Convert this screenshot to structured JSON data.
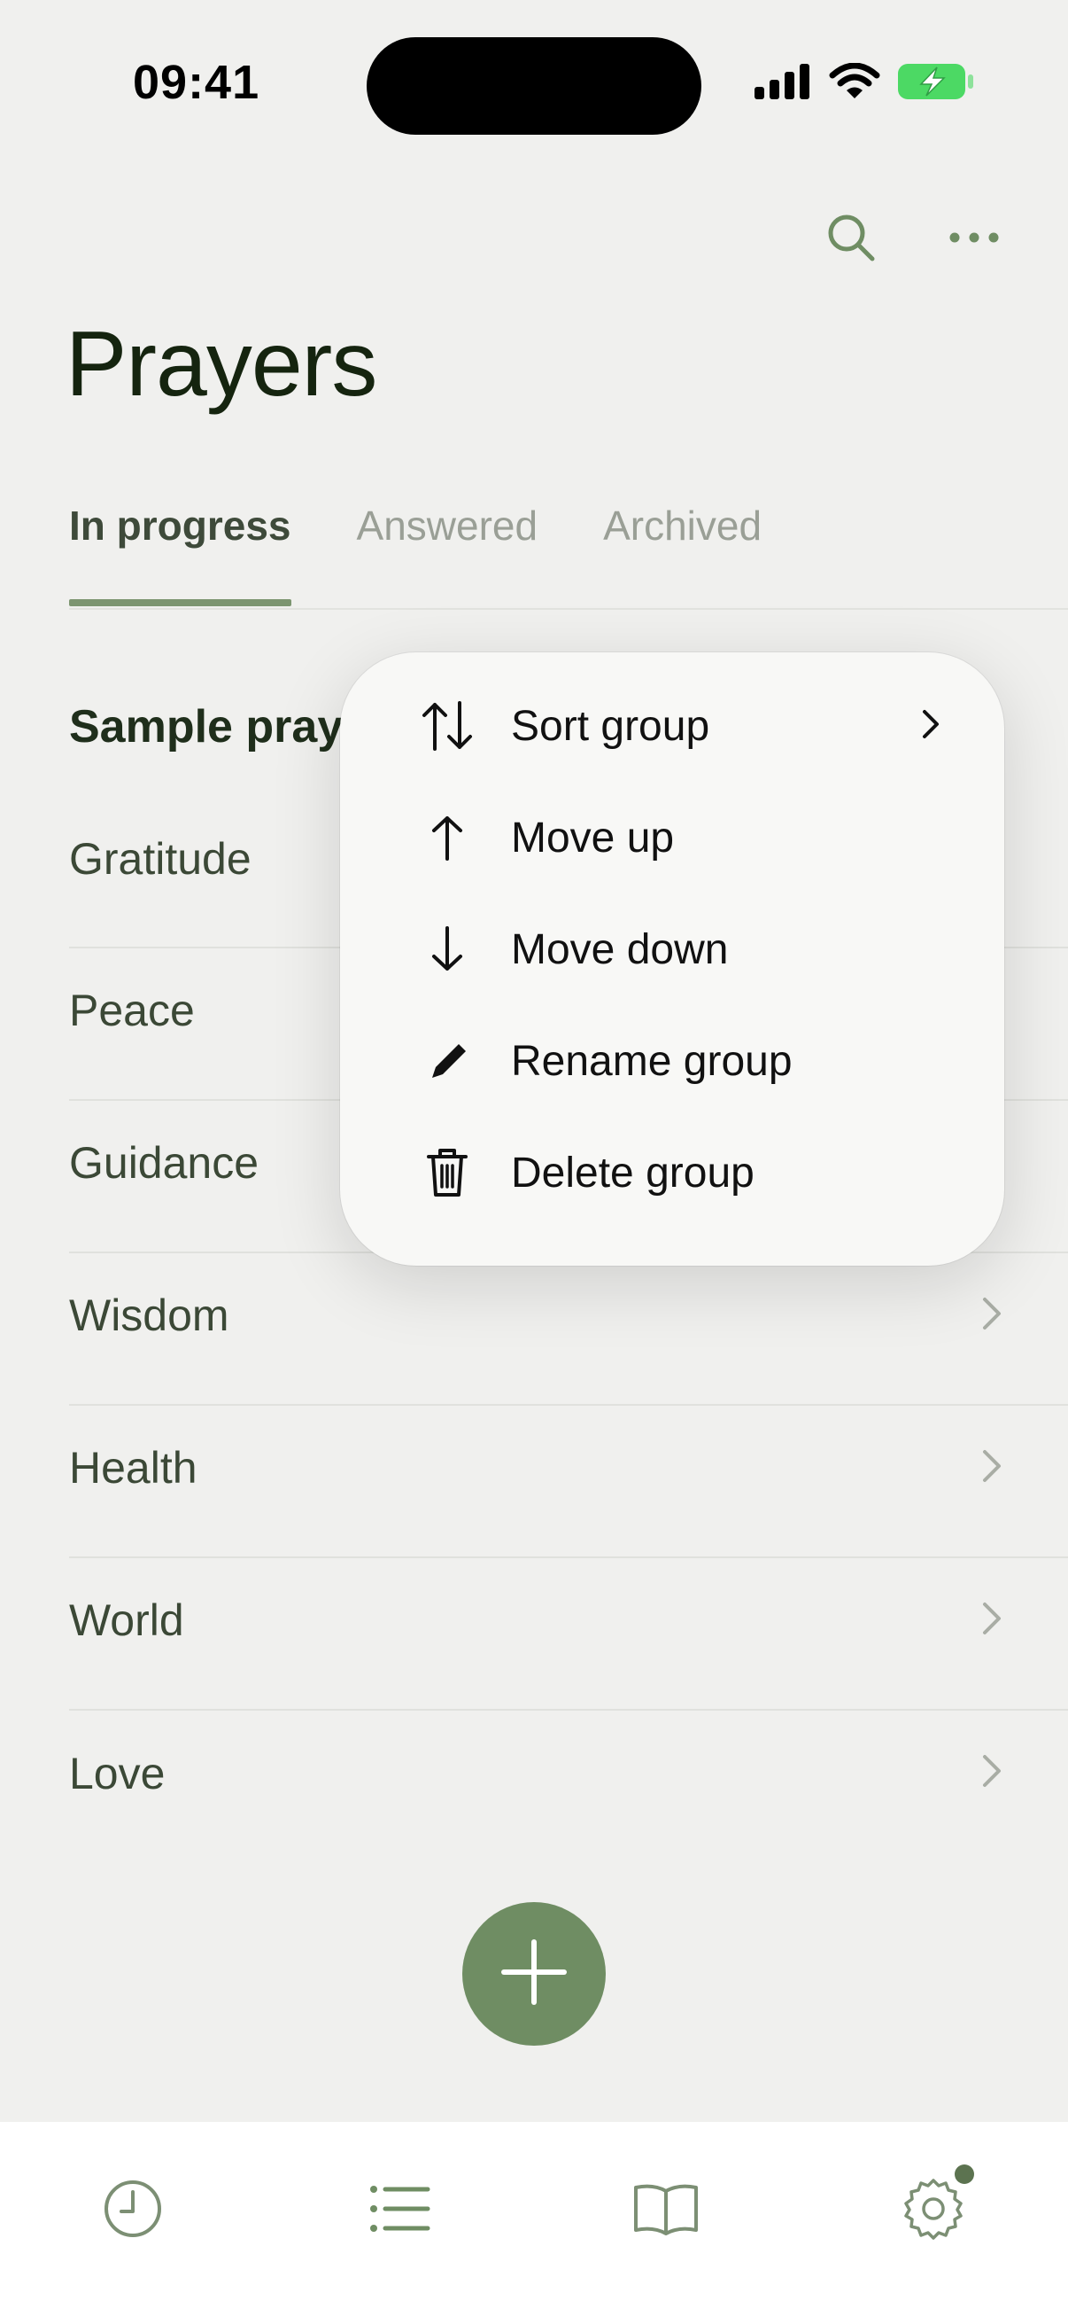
{
  "status_bar": {
    "time": "09:41"
  },
  "header": {
    "title": "Prayers"
  },
  "tabs": [
    {
      "label": "In progress",
      "active": true
    },
    {
      "label": "Answered",
      "active": false
    },
    {
      "label": "Archived",
      "active": false
    }
  ],
  "group": {
    "title": "Sample prayers"
  },
  "list": [
    {
      "label": "Gratitude"
    },
    {
      "label": "Peace"
    },
    {
      "label": "Guidance"
    },
    {
      "label": "Wisdom"
    },
    {
      "label": "Health"
    },
    {
      "label": "World"
    },
    {
      "label": "Love"
    }
  ],
  "menu": {
    "items": [
      {
        "label": "Sort group",
        "icon": "sort-icon"
      },
      {
        "label": "Move up",
        "icon": "arrow-up-icon"
      },
      {
        "label": "Move down",
        "icon": "arrow-down-icon"
      },
      {
        "label": "Rename group",
        "icon": "pencil-icon"
      },
      {
        "label": "Delete group",
        "icon": "trash-icon"
      }
    ]
  },
  "tabbar": {
    "items": [
      {
        "icon": "clock-icon"
      },
      {
        "icon": "list-icon"
      },
      {
        "icon": "book-icon"
      },
      {
        "icon": "gear-icon",
        "badge": true
      }
    ]
  },
  "colors": {
    "accent": "#6f8d63",
    "background": "#f0f0ee",
    "title": "#15240f",
    "battery": "#4cd964"
  }
}
